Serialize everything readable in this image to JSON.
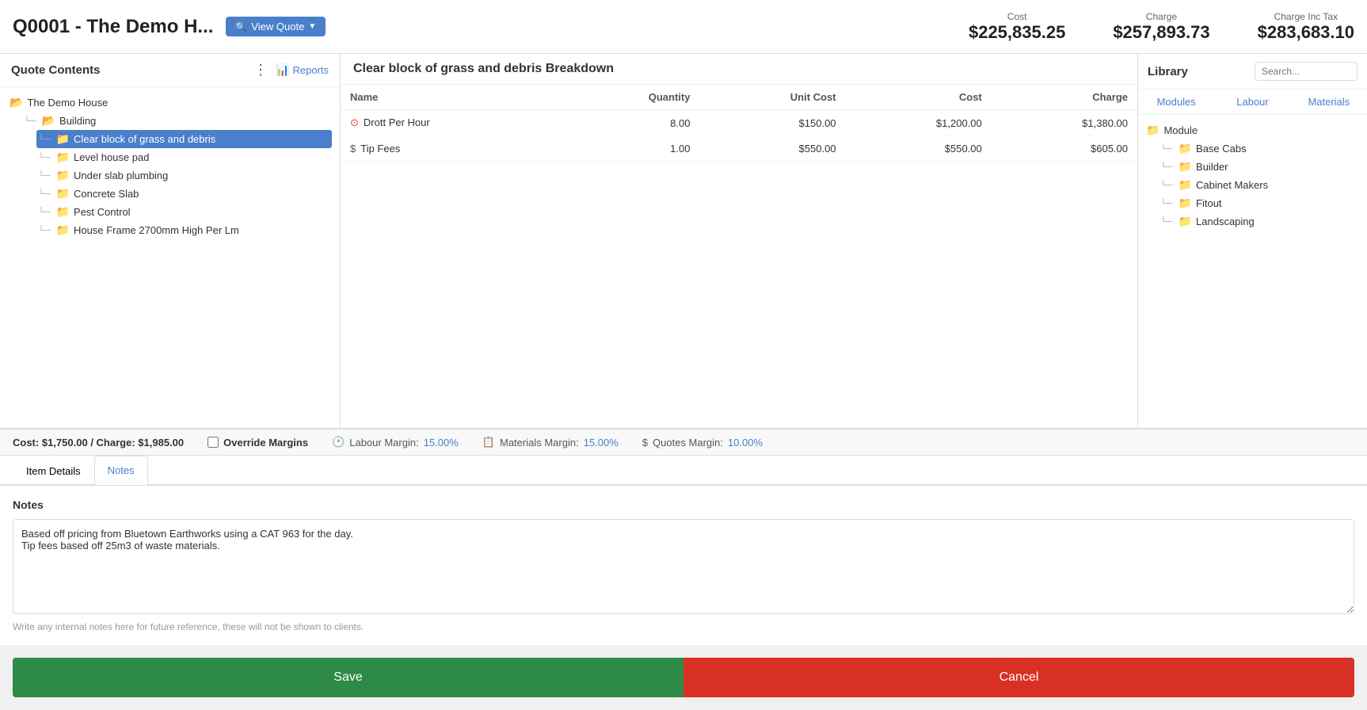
{
  "header": {
    "quote_title": "Q0001 - The Demo H...",
    "view_quote_label": "View Quote",
    "stats": {
      "cost_label": "Cost",
      "cost_value": "$225,835.25",
      "charge_label": "Charge",
      "charge_value": "$257,893.73",
      "charge_inc_tax_label": "Charge Inc Tax",
      "charge_inc_tax_value": "$283,683.10"
    }
  },
  "sidebar": {
    "title": "Quote Contents",
    "reports_label": "Reports",
    "tree": [
      {
        "level": 0,
        "label": "The Demo House",
        "type": "folder",
        "open": true
      },
      {
        "level": 1,
        "label": "Building",
        "type": "folder",
        "open": true
      },
      {
        "level": 2,
        "label": "Clear block of grass and debris",
        "type": "folder",
        "selected": true
      },
      {
        "level": 2,
        "label": "Level house pad",
        "type": "folder"
      },
      {
        "level": 2,
        "label": "Under slab plumbing",
        "type": "folder"
      },
      {
        "level": 2,
        "label": "Concrete Slab",
        "type": "folder"
      },
      {
        "level": 2,
        "label": "Pest Control",
        "type": "folder"
      },
      {
        "level": 2,
        "label": "House Frame 2700mm High Per Lm",
        "type": "folder"
      }
    ]
  },
  "breakdown": {
    "title": "Clear block of grass and debris Breakdown",
    "columns": [
      "Name",
      "Quantity",
      "Unit Cost",
      "Cost",
      "Charge"
    ],
    "rows": [
      {
        "icon": "clock",
        "name": "Drott Per Hour",
        "quantity": "8.00",
        "unit_cost": "$150.00",
        "cost": "$1,200.00",
        "charge": "$1,380.00"
      },
      {
        "icon": "dollar",
        "name": "Tip Fees",
        "quantity": "1.00",
        "unit_cost": "$550.00",
        "cost": "$550.00",
        "charge": "$605.00"
      }
    ]
  },
  "library": {
    "title": "Library",
    "search_placeholder": "Search...",
    "tabs": [
      "Modules",
      "Labour",
      "Materials"
    ],
    "active_tab": "Modules",
    "tree": [
      {
        "level": 0,
        "label": "Module",
        "type": "folder"
      },
      {
        "level": 1,
        "label": "Base Cabs",
        "type": "folder"
      },
      {
        "level": 1,
        "label": "Builder",
        "type": "folder"
      },
      {
        "level": 1,
        "label": "Cabinet Makers",
        "type": "folder"
      },
      {
        "level": 1,
        "label": "Fitout",
        "type": "folder"
      },
      {
        "level": 1,
        "label": "Landscaping",
        "type": "folder"
      }
    ]
  },
  "status_bar": {
    "cost_label": "Cost:",
    "cost_value": "$1,750.00",
    "charge_label": "/ Charge:",
    "charge_value": "$1,985.00",
    "override_label": "Override Margins",
    "labour_margin_label": "Labour Margin:",
    "labour_margin_value": "15.00%",
    "materials_margin_label": "Materials Margin:",
    "materials_margin_value": "15.00%",
    "quotes_margin_label": "Quotes Margin:",
    "quotes_margin_value": "10.00%"
  },
  "tabs": {
    "item_details_label": "Item Details",
    "notes_label": "Notes",
    "active": "notes"
  },
  "notes": {
    "heading": "Notes",
    "content": "Based off pricing from Bluetown Earthworks using a CAT 963 for the day.\nTip fees based off 25m3 of waste materials.",
    "hint": "Write any internal notes here for future reference, these will not be shown to clients."
  },
  "actions": {
    "save_label": "Save",
    "cancel_label": "Cancel"
  }
}
